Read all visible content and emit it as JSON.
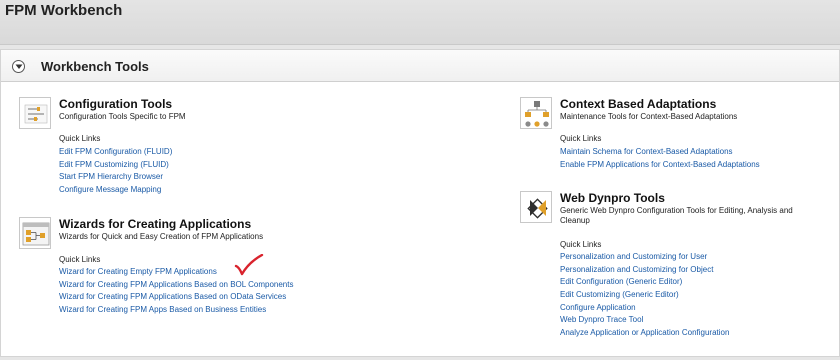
{
  "app": {
    "title": "FPM Workbench"
  },
  "panel": {
    "title": "Workbench Tools",
    "collapse_icon": "chevron-down-icon"
  },
  "groups": {
    "configuration_tools": {
      "icon": "configuration-tools-icon",
      "title": "Configuration Tools",
      "description": "Configuration Tools Specific to FPM",
      "quick_links_label": "Quick Links",
      "links": [
        "Edit FPM Configuration (FLUID)",
        "Edit FPM Customizing (FLUID)",
        "Start FPM Hierarchy Browser",
        "Configure Message Mapping"
      ]
    },
    "wizards": {
      "icon": "wizard-icon",
      "title": "Wizards for Creating Applications",
      "description": "Wizards for Quick and Easy Creation of FPM Applications",
      "quick_links_label": "Quick Links",
      "links": [
        "Wizard for Creating Empty FPM Applications",
        "Wizard for Creating FPM Applications Based on BOL Components",
        "Wizard for Creating FPM Applications Based on OData Services",
        "Wizard for Creating FPM Apps Based on Business Entities"
      ]
    },
    "context_adaptations": {
      "icon": "hierarchy-icon",
      "title": "Context Based Adaptations",
      "description": "Maintenance Tools for Context-Based Adaptations",
      "quick_links_label": "Quick Links",
      "links": [
        "Maintain Schema for Context-Based Adaptations",
        "Enable FPM Applications for Context-Based Adaptations"
      ]
    },
    "web_dynpro_tools": {
      "icon": "web-dynpro-icon",
      "title": "Web Dynpro Tools",
      "description": "Generic Web Dynpro Configuration Tools for Editing, Analysis and Cleanup",
      "quick_links_label": "Quick Links",
      "links": [
        "Personalization and Customizing for User",
        "Personalization and Customizing for Object",
        "Edit Configuration (Generic Editor)",
        "Edit Customizing (Generic Editor)",
        "Configure Application",
        "Web Dynpro Trace Tool",
        "Analyze Application or Application Configuration"
      ]
    }
  },
  "annotation": {
    "icon": "red-checkmark-icon",
    "color": "#d9232d"
  }
}
